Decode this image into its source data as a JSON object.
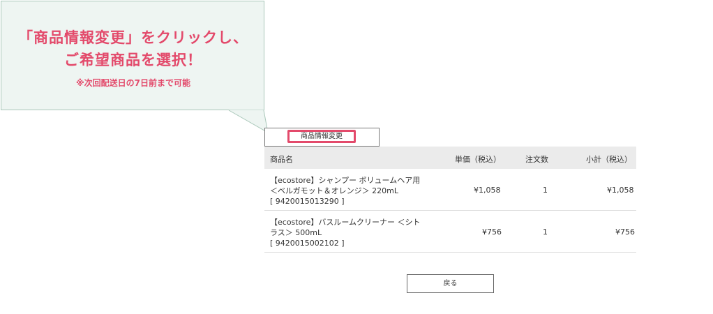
{
  "callout": {
    "title_line1": "「商品情報変更」をクリックし、",
    "title_line2": "ご希望商品を選択！",
    "note": "※次回配送日の7日前まで可能"
  },
  "buttons": {
    "change_label": "商品情報変更",
    "back_label": "戻る"
  },
  "table": {
    "headers": {
      "name": "商品名",
      "unit_price": "単価（税込）",
      "qty": "注文数",
      "subtotal": "小計（税込）"
    },
    "rows": [
      {
        "name_line1": "【ecostore】シャンプー ボリュームヘア用",
        "name_line2": "＜ベルガモット＆オレンジ＞ 220mL",
        "code": "[ 9420015013290 ]",
        "unit_price": "¥1,058",
        "qty": "1",
        "subtotal": "¥1,058"
      },
      {
        "name_line1": "【ecostore】バスルームクリーナー ＜シト",
        "name_line2": "ラス＞ 500mL",
        "code": "[ 9420015002102 ]",
        "unit_price": "¥756",
        "qty": "1",
        "subtotal": "¥756"
      }
    ]
  },
  "colors": {
    "accent": "#e34a6b",
    "callout_bg": "#eef5f2",
    "callout_border": "#a9c7b9",
    "header_bg": "#ebebeb"
  }
}
